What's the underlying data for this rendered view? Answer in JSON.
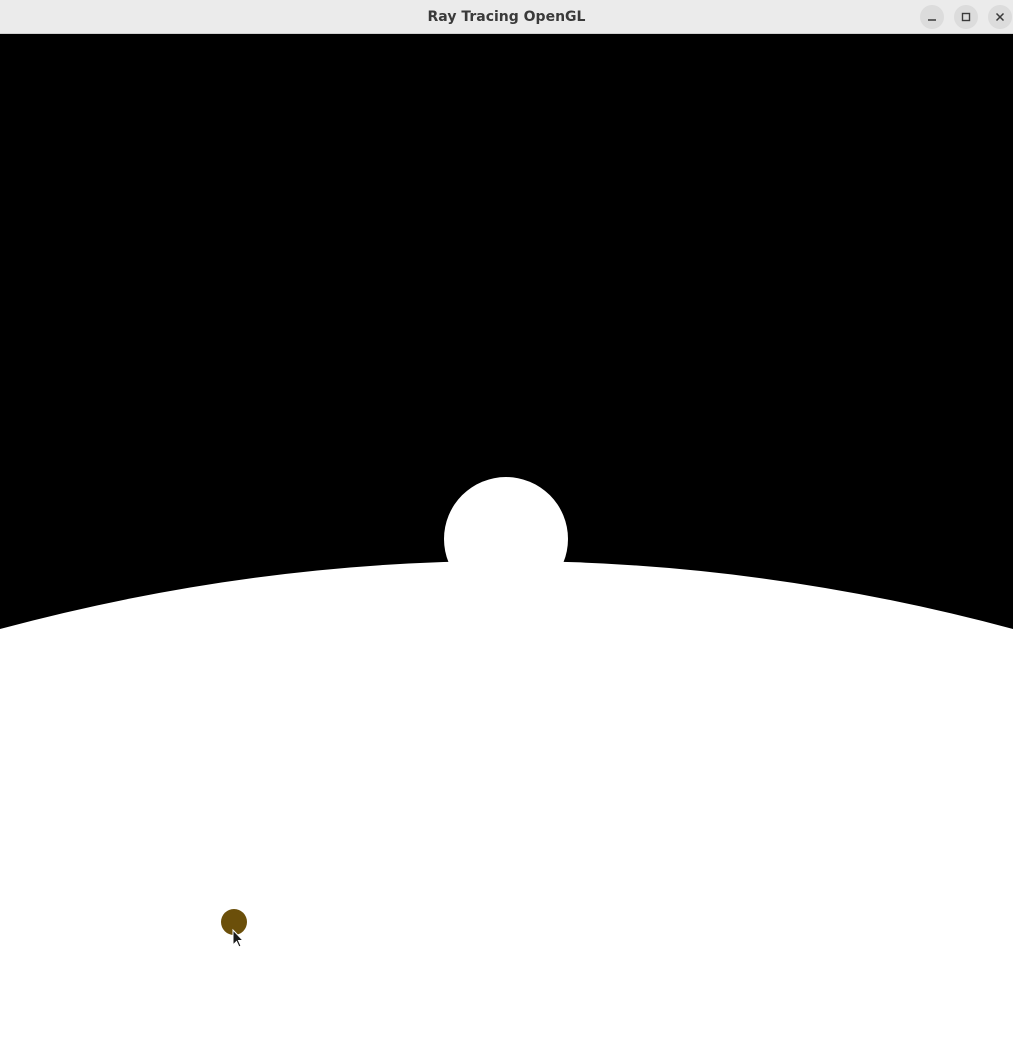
{
  "window": {
    "title": "Ray Tracing OpenGL",
    "controls": {
      "minimize": "minimize-icon",
      "maximize": "maximize-icon",
      "close": "close-icon"
    }
  },
  "scene": {
    "background_color": "#000000",
    "ground_color": "#ffffff",
    "sphere_color": "#ffffff",
    "small_sphere_color": "#6b4f0a"
  }
}
